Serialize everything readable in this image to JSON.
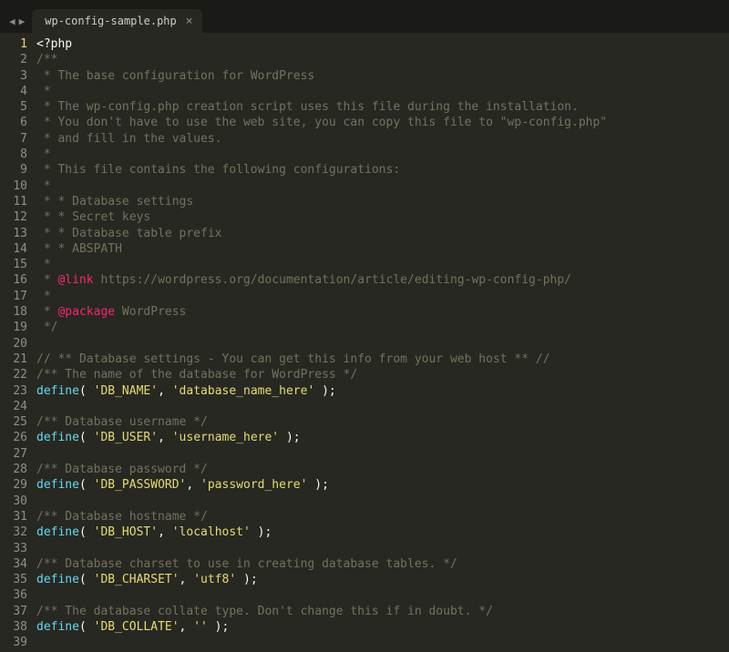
{
  "tab": {
    "name": "wp-config-sample.php"
  },
  "nav": {
    "back": "◀",
    "fwd": "▶"
  },
  "lines": [
    {
      "n": 1,
      "t": "php_open",
      "text": "<?php"
    },
    {
      "n": 2,
      "t": "comment",
      "text": "/**"
    },
    {
      "n": 3,
      "t": "comment",
      "text": " * The base configuration for WordPress"
    },
    {
      "n": 4,
      "t": "comment",
      "text": " *"
    },
    {
      "n": 5,
      "t": "comment",
      "text": " * The wp-config.php creation script uses this file during the installation."
    },
    {
      "n": 6,
      "t": "comment",
      "text": " * You don't have to use the web site, you can copy this file to \"wp-config.php\""
    },
    {
      "n": 7,
      "t": "comment",
      "text": " * and fill in the values."
    },
    {
      "n": 8,
      "t": "comment",
      "text": " *"
    },
    {
      "n": 9,
      "t": "comment",
      "text": " * This file contains the following configurations:"
    },
    {
      "n": 10,
      "t": "comment",
      "text": " *"
    },
    {
      "n": 11,
      "t": "comment",
      "text": " * * Database settings"
    },
    {
      "n": 12,
      "t": "comment",
      "text": " * * Secret keys"
    },
    {
      "n": 13,
      "t": "comment",
      "text": " * * Database table prefix"
    },
    {
      "n": 14,
      "t": "comment",
      "text": " * * ABSPATH"
    },
    {
      "n": 15,
      "t": "comment",
      "text": " *"
    },
    {
      "n": 16,
      "t": "ann_link",
      "prefix": " * ",
      "ann": "@link",
      "rest": " https://wordpress.org/documentation/article/editing-wp-config-php/"
    },
    {
      "n": 17,
      "t": "comment",
      "text": " *"
    },
    {
      "n": 18,
      "t": "ann_pkg",
      "prefix": " * ",
      "ann": "@package",
      "rest": " WordPress"
    },
    {
      "n": 19,
      "t": "comment",
      "text": " */"
    },
    {
      "n": 20,
      "t": "blank",
      "text": ""
    },
    {
      "n": 21,
      "t": "comment",
      "text": "// ** Database settings - You can get this info from your web host ** //"
    },
    {
      "n": 22,
      "t": "comment",
      "text": "/** The name of the database for WordPress */"
    },
    {
      "n": 23,
      "t": "define",
      "key": "'DB_NAME'",
      "val": "'database_name_here'"
    },
    {
      "n": 24,
      "t": "blank",
      "text": ""
    },
    {
      "n": 25,
      "t": "comment",
      "text": "/** Database username */"
    },
    {
      "n": 26,
      "t": "define",
      "key": "'DB_USER'",
      "val": "'username_here'"
    },
    {
      "n": 27,
      "t": "blank",
      "text": ""
    },
    {
      "n": 28,
      "t": "comment",
      "text": "/** Database password */"
    },
    {
      "n": 29,
      "t": "define",
      "key": "'DB_PASSWORD'",
      "val": "'password_here'"
    },
    {
      "n": 30,
      "t": "blank",
      "text": ""
    },
    {
      "n": 31,
      "t": "comment",
      "text": "/** Database hostname */"
    },
    {
      "n": 32,
      "t": "define",
      "key": "'DB_HOST'",
      "val": "'localhost'"
    },
    {
      "n": 33,
      "t": "blank",
      "text": ""
    },
    {
      "n": 34,
      "t": "comment",
      "text": "/** Database charset to use in creating database tables. */"
    },
    {
      "n": 35,
      "t": "define",
      "key": "'DB_CHARSET'",
      "val": "'utf8'"
    },
    {
      "n": 36,
      "t": "blank",
      "text": ""
    },
    {
      "n": 37,
      "t": "comment",
      "text": "/** The database collate type. Don't change this if in doubt. */"
    },
    {
      "n": 38,
      "t": "define",
      "key": "'DB_COLLATE'",
      "val": "''"
    },
    {
      "n": 39,
      "t": "blank",
      "text": ""
    }
  ]
}
